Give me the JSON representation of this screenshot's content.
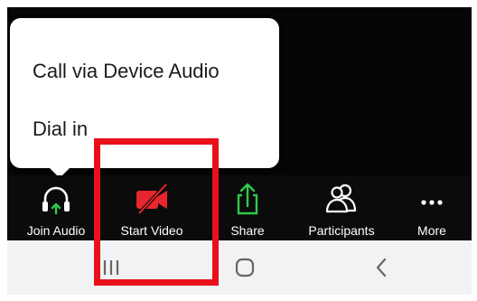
{
  "audio_menu": {
    "items": [
      {
        "label": "Call via Device Audio"
      },
      {
        "label": "Dial in"
      }
    ]
  },
  "toolbar": {
    "join_audio": {
      "label": "Join Audio",
      "icon": "headphones-icon"
    },
    "start_video": {
      "label": "Start Video",
      "icon": "video-off-icon"
    },
    "share": {
      "label": "Share",
      "icon": "share-icon"
    },
    "participants": {
      "label": "Participants",
      "icon": "participants-icon"
    },
    "more": {
      "label": "More",
      "icon": "more-icon"
    }
  },
  "nav": {
    "recents": {
      "icon": "recents-icon"
    },
    "home": {
      "icon": "home-icon"
    },
    "back": {
      "icon": "back-icon"
    }
  },
  "colors": {
    "video_off_red": "#e8262d",
    "share_green": "#2eca4e",
    "audio_arrow_green": "#2eca4e",
    "highlight_red": "#e8111b",
    "toolbar_bg": "#0b0b0b"
  }
}
